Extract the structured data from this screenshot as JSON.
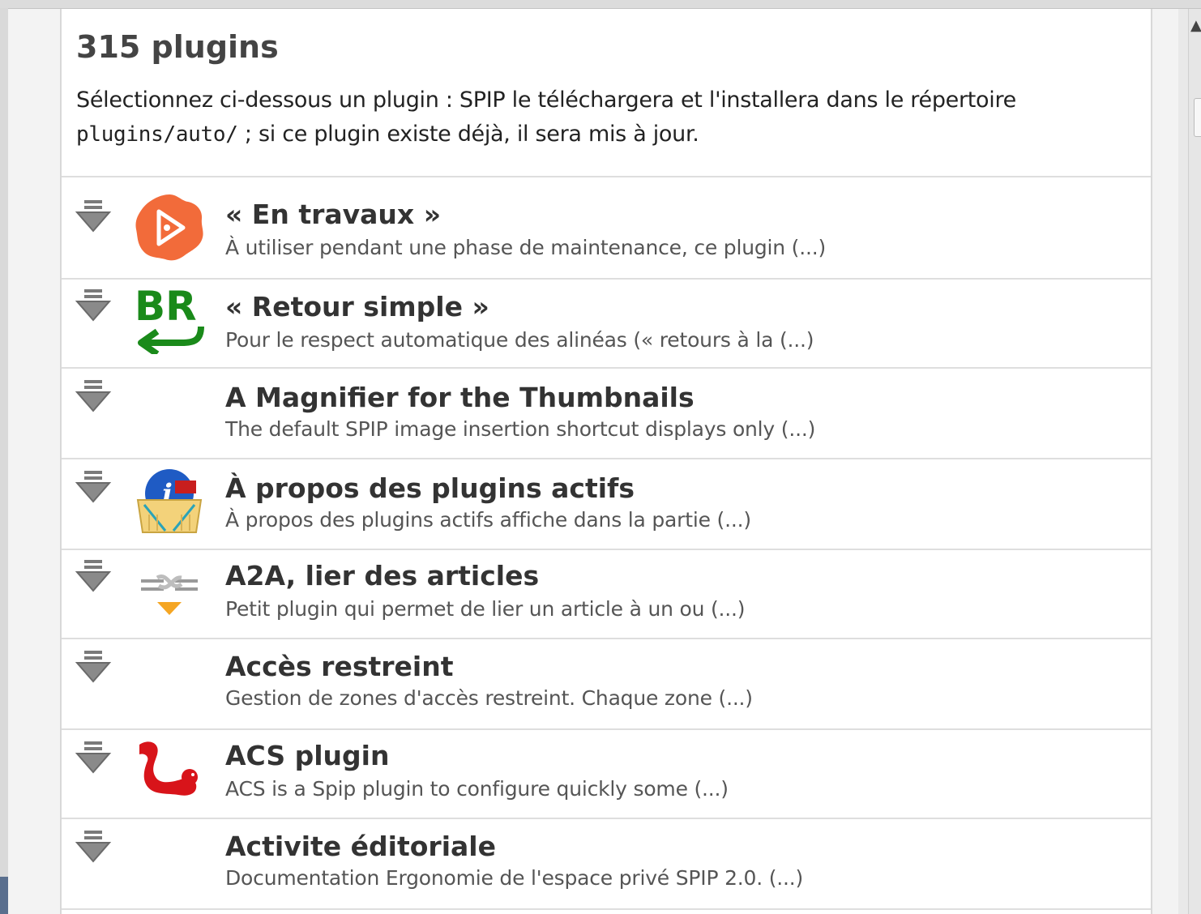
{
  "header": {
    "title": "315 plugins",
    "intro_before": "Sélectionnez ci-dessous un plugin : SPIP le téléchargera et l'installera dans le répertoire",
    "intro_code": "plugins/auto/",
    "intro_after": " ; si ce plugin existe déjà, il sera mis à jour."
  },
  "plugins": [
    {
      "name": "« En travaux »",
      "desc": "À utiliser pendant une phase de maintenance, ce plugin (...)",
      "logo": "en-travaux-logo"
    },
    {
      "name": "« Retour simple »",
      "desc": "Pour le respect automatique des alinéas (« retours à la (...)",
      "logo": "br-return-logo",
      "logo_text": "BR"
    },
    {
      "name": "A Magnifier for the Thumbnails",
      "desc": "The default SPIP image insertion shortcut displays only (...)",
      "logo": ""
    },
    {
      "name": "À propos des plugins actifs",
      "desc": "À propos des plugins actifs affiche dans la partie (...)",
      "logo": "info-basket-logo"
    },
    {
      "name": "A2A, lier des articles",
      "desc": "Petit plugin qui permet de lier un article à un ou (...)",
      "logo": "chain-link-logo"
    },
    {
      "name": "Accès restreint",
      "desc": "Gestion de zones d'accès restreint. Chaque zone (...)",
      "logo": ""
    },
    {
      "name": "ACS plugin",
      "desc": "ACS is a Spip plugin to configure quickly some (...)",
      "logo": "red-squirrel-logo"
    },
    {
      "name": "Activite éditoriale",
      "desc": "Documentation Ergonomie de l'espace privé SPIP 2.0. (...)",
      "logo": ""
    }
  ],
  "icons": {
    "download": "download-arrow-icon"
  },
  "colors": {
    "logo_orange": "#f26b3a",
    "logo_green": "#1a8a1a",
    "logo_red": "#d8141a"
  }
}
